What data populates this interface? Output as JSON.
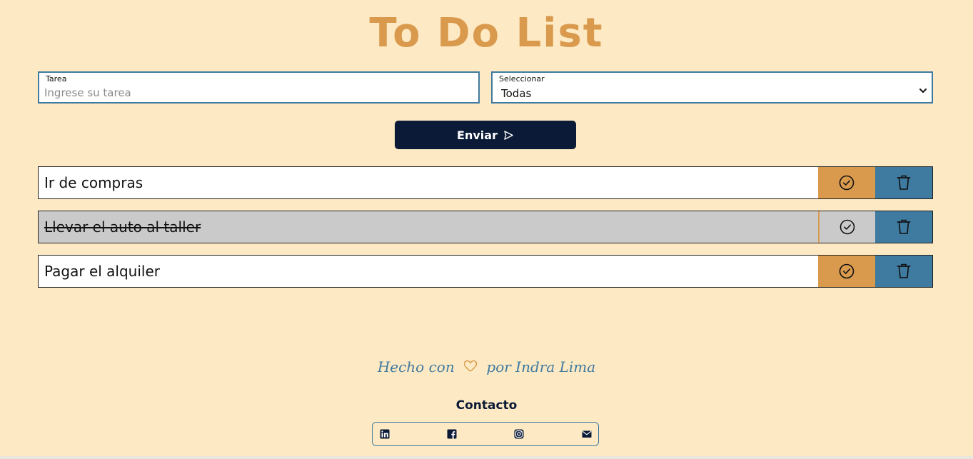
{
  "app": {
    "title": "To Do List"
  },
  "form": {
    "task_label": "Tarea",
    "task_placeholder": "Ingrese su tarea",
    "task_value": "",
    "filter_label": "Seleccionar",
    "filter_value": "Todas",
    "submit_label": "Enviar"
  },
  "tasks": [
    {
      "text": "Ir de compras",
      "completed": false
    },
    {
      "text": "Llevar el auto al taller",
      "completed": true
    },
    {
      "text": "Pagar el alquiler",
      "completed": false
    }
  ],
  "footer": {
    "made_with_prefix": "Hecho con",
    "made_with_suffix": "por Indra Lima",
    "contact_title": "Contacto",
    "social_icons": [
      "linkedin-icon",
      "facebook-icon",
      "instagram-icon",
      "mail-icon"
    ]
  },
  "colors": {
    "background": "#fde9c3",
    "accent_orange": "#d99a4e",
    "accent_blue": "#3f7aa0",
    "button_dark": "#0b1a36",
    "completed_row": "#cacaca"
  }
}
